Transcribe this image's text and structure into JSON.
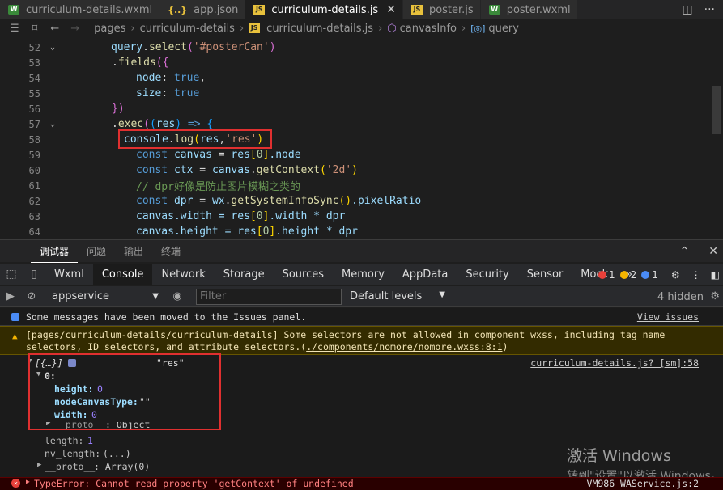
{
  "tabs": [
    {
      "label": "curriculum-details.wxml",
      "icon": "wxml-icon",
      "glyph": "W",
      "active": false
    },
    {
      "label": "app.json",
      "icon": "json-icon",
      "glyph": "{..}",
      "active": false
    },
    {
      "label": "curriculum-details.js",
      "icon": "js-icon",
      "glyph": "JS",
      "active": true
    },
    {
      "label": "poster.js",
      "icon": "js-icon",
      "glyph": "JS",
      "active": false
    },
    {
      "label": "poster.wxml",
      "icon": "wxml-icon",
      "glyph": "W",
      "active": false
    }
  ],
  "breadcrumb": {
    "items": [
      "pages",
      "curriculum-details",
      "curriculum-details.js",
      "canvasInfo",
      "query"
    ],
    "js_glyph": "JS"
  },
  "editor": {
    "lines": [
      {
        "n": "52",
        "fold": "v"
      },
      {
        "n": "53",
        "fold": ""
      },
      {
        "n": "54",
        "fold": ""
      },
      {
        "n": "55",
        "fold": ""
      },
      {
        "n": "56",
        "fold": ""
      },
      {
        "n": "57",
        "fold": "v"
      },
      {
        "n": "58",
        "fold": ""
      },
      {
        "n": "59",
        "fold": ""
      },
      {
        "n": "60",
        "fold": ""
      },
      {
        "n": "61",
        "fold": ""
      },
      {
        "n": "62",
        "fold": ""
      },
      {
        "n": "63",
        "fold": ""
      },
      {
        "n": "64",
        "fold": ""
      }
    ],
    "code": {
      "l52_a": "query",
      "l52_b": ".",
      "l52_c": "select",
      "l52_d": "(",
      "l52_e": "'#posterCan'",
      "l52_f": ")",
      "l53_a": ".",
      "l53_b": "fields",
      "l53_c": "({",
      "l54_a": "node",
      "l54_b": ": ",
      "l54_c": "true",
      "l54_d": ",",
      "l55_a": "size",
      "l55_b": ": ",
      "l55_c": "true",
      "l56_a": "})",
      "l57_a": ".",
      "l57_b": "exec",
      "l57_c": "(",
      "l57_d": "(",
      "l57_e": "res",
      "l57_f": ")",
      "l57_g": " => ",
      "l57_h": "{",
      "l58_a": "console",
      "l58_b": ".",
      "l58_c": "log",
      "l58_d": "(",
      "l58_e": "res",
      "l58_f": ",",
      "l58_g": "'res'",
      "l58_h": ")",
      "l59_a": "const ",
      "l59_b": "canvas",
      "l59_c": " = ",
      "l59_d": "res",
      "l59_e": "[",
      "l59_f": "0",
      "l59_g": "]",
      "l59_h": ".node",
      "l60_a": "const ",
      "l60_b": "ctx",
      "l60_c": " = ",
      "l60_d": "canvas",
      "l60_e": ".",
      "l60_f": "getContext",
      "l60_g": "(",
      "l60_h": "'2d'",
      "l60_i": ")",
      "l61_a": "// dpr好像是防止图片模糊之类的",
      "l62_a": "const ",
      "l62_b": "dpr",
      "l62_c": " = ",
      "l62_d": "wx",
      "l62_e": ".",
      "l62_f": "getSystemInfoSync",
      "l62_g": "()",
      "l62_h": ".pixelRatio",
      "l63_a": "canvas",
      "l63_b": ".width = ",
      "l63_c": "res",
      "l63_d": "[",
      "l63_e": "0",
      "l63_f": "]",
      ".l63_g": "",
      "l63_h": ".width * dpr",
      "l64_a": "canvas",
      "l64_b": ".height = ",
      "l64_c": "res",
      "l64_d": "[",
      "l64_e": "0",
      "l64_f": "]",
      "l64_h": ".height * dpr"
    }
  },
  "panel": {
    "tabs": [
      "调试器",
      "问题",
      "输出",
      "终端"
    ],
    "active": "调试器"
  },
  "devtools": {
    "tabs": [
      "Wxml",
      "Console",
      "Network",
      "Storage",
      "Sources",
      "Memory",
      "AppData",
      "Security",
      "Sensor",
      "Mock"
    ],
    "active": "Console",
    "more": "»",
    "errors": "1",
    "warnings": "2",
    "infos": "1"
  },
  "filterbar": {
    "context": "appservice",
    "filter_placeholder": "Filter",
    "levels": "Default levels",
    "hidden": "4 hidden"
  },
  "console": {
    "msg1": "Some messages have been moved to the Issues panel.",
    "msg1_link": "View issues",
    "msg2_text": "[pages/curriculum-details/curriculum-details] Some selectors are not allowed in component wxss, including tag name selectors, ID selectors, and attribute selectors.(",
    "msg2_link": "./components/nomore/nomore.wxss:8:1",
    "msg2_end": ")",
    "log_obj": "[{…}]",
    "log_str": "\"res\"",
    "log_src": "curriculum-details.js? [sm]:58",
    "item0": "0:",
    "height_k": "height:",
    "height_v": "0",
    "nct_k": "nodeCanvasType:",
    "nct_v": "\"\"",
    "width_k": "width:",
    "width_v": "0",
    "proto1_k": "__proto__",
    "proto1_v": ": Object",
    "length_k": "length:",
    "length_v": "1",
    "nvlen_k": "nv_length:",
    "nvlen_v": "(...)",
    "proto2_k": "__proto__",
    "proto2_v": ": Array(0)",
    "error": "TypeError: Cannot read property 'getContext' of undefined",
    "error_src": "VM986 WAService.js:2"
  },
  "watermark": {
    "line1": "激活 Windows",
    "line2": "转到\"设置\"以激活 Windows。"
  }
}
